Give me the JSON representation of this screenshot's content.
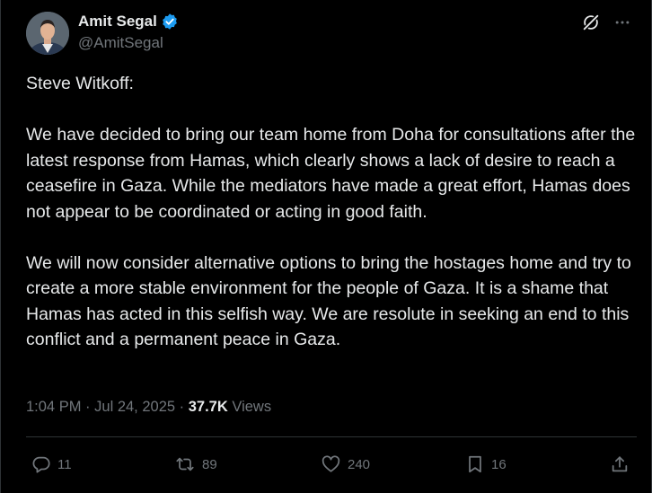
{
  "author": {
    "display_name": "Amit Segal",
    "handle": "@AmitSegal",
    "verified": true,
    "verified_color": "#1d9bf0"
  },
  "tweet": {
    "text": "Steve Witkoff:\n\nWe have decided to bring our team home from Doha for consultations after the latest response from Hamas, which clearly shows a lack of desire to reach a ceasefire in Gaza. While the mediators have made a great effort, Hamas does not appear to be coordinated or acting in good faith.\n\nWe will now consider alternative options to bring the hostages home and try to create a more stable environment for the people of Gaza. It is a shame that Hamas has acted in this selfish way. We are resolute in seeking an end to this conflict and a permanent peace in Gaza.",
    "time": "1:04 PM",
    "date": "Jul 24, 2025",
    "views_count": "37.7K",
    "views_label": "Views"
  },
  "top_icons": [
    "grok-icon",
    "more-icon"
  ],
  "actions": {
    "replies": "11",
    "reposts": "89",
    "likes": "240",
    "bookmarks": "16"
  }
}
